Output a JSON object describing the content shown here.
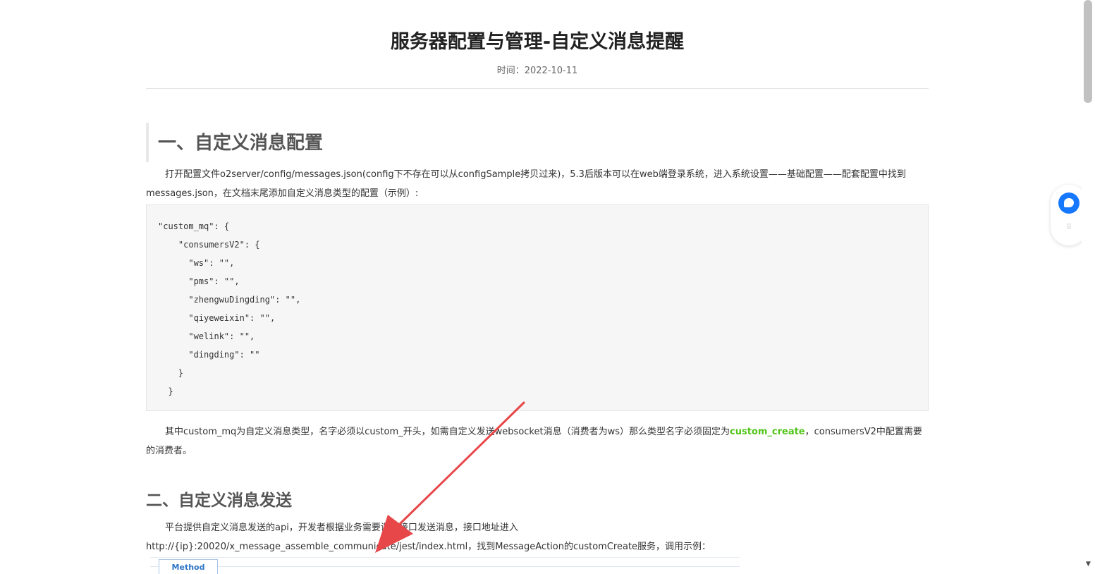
{
  "article": {
    "title": "服务器配置与管理-自定义消息提醒",
    "date_label": "时间：",
    "date_value": "2022-10-11"
  },
  "section1": {
    "heading": "一、自定义消息配置",
    "para1": "打开配置文件o2server/config/messages.json(config下不存在可以从configSample拷贝过来)，5.3后版本可以在web端登录系统，进入系统设置——基础配置——配套配置中找到messages.json，在文档末尾添加自定义消息类型的配置（示例）:",
    "code_lines": [
      "\"custom_mq\": {",
      "    \"consumersV2\": {",
      "      \"ws\": \"\",",
      "      \"pms\": \"\",",
      "      \"zhengwuDingding\": \"\",",
      "      \"qiyeweixin\": \"\",",
      "      \"welink\": \"\",",
      "      \"dingding\": \"\"",
      "    }",
      "  }"
    ],
    "para2_before": "其中custom_mq为自定义消息类型，名字必须以custom_开头，如需自定义发送websocket消息（消费者为ws）那么类型名字必须固定为",
    "para2_highlight": "custom_create",
    "para2_after": "，consumersV2中配置需要的消费者。"
  },
  "section2": {
    "heading": "二、自定义消息发送",
    "para1": "平台提供自定义消息发送的api，开发者根据业务需要调用接口发送消息，接口地址进入",
    "para2": "http://{ip}:20020/x_message_assemble_communicate/jest/index.html，找到MessageAction的customCreate服务，调用示例：",
    "method_tab": "Method"
  },
  "colors": {
    "highlight": "#52c41a",
    "arrow": "#e8474a",
    "chat_button": "#1677ff"
  },
  "icons": {
    "chat": "chat-bubble-icon",
    "drag": "drag-handle-icon",
    "scroll_up": "scroll-up-arrow-icon",
    "scroll_down": "scroll-down-arrow-icon"
  }
}
